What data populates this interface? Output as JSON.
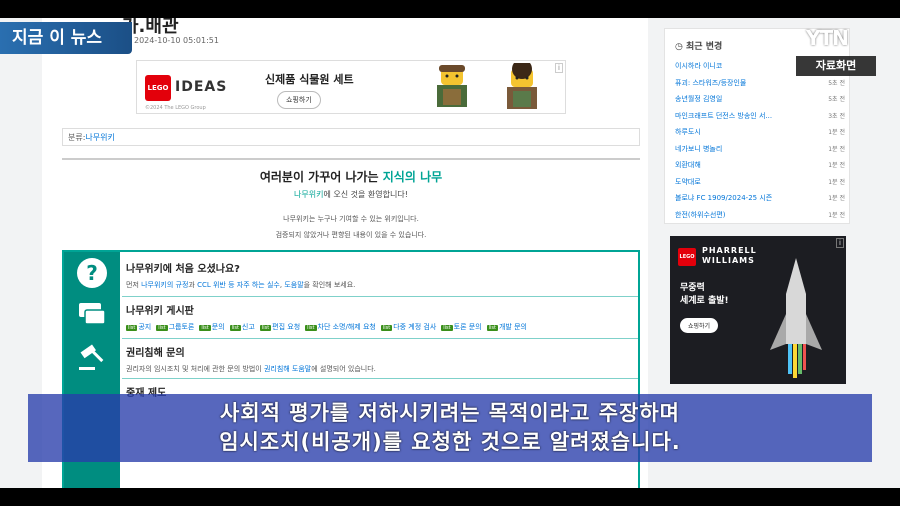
{
  "broadcast": {
    "news_label": "지금 이 뉴스",
    "channel_logo": "YTN",
    "archive_badge": "자료화면",
    "subtitle_line1": "사회적 평가를 저하시키려는 목적이라고 주장하며",
    "subtitle_line2": "임시조치(비공개)를 요청한 것으로 알려졌습니다."
  },
  "document": {
    "title": "가.배관",
    "date": "2024-10-10 05:01:51"
  },
  "ad_lego": {
    "brand": "LEGO",
    "line": "IDEAS",
    "headline": "신제품 식물원 세트",
    "cta": "쇼핑하기",
    "copyright": "©2024 The LEGO Group"
  },
  "category": {
    "label": "분류:",
    "link": "나무위키"
  },
  "welcome": {
    "title_prefix": "여러분이 가꾸어 나가는 ",
    "title_highlight": "지식의 나무",
    "sub_link": "나무위키",
    "sub_text": "에 오신 것을 환영합니다!",
    "note1": "나무위키는 누구나 기여할 수 있는 위키입니다.",
    "note2": "검증되지 않았거나 편향된 내용이 있을 수 있습니다."
  },
  "help": {
    "first_title": "나무위키에 처음 오셨나요?",
    "first_desc_a": "먼저 ",
    "first_desc_link1": "나무위키의 규정",
    "first_desc_b": "과 ",
    "first_desc_link2": "CCL 위반 등 자주 하는 실수",
    "first_desc_c": ", ",
    "first_desc_link3": "도움말",
    "first_desc_d": "을 확인해 보세요.",
    "board_title": "나무위키 게시판",
    "board_links": [
      "공지",
      "그룹토론",
      "문의",
      "신고",
      "편집 요청",
      "차단 소명/해제 요청",
      "다중 계정 검사",
      "토론 문의",
      "개발 문의"
    ],
    "board_tag": "list",
    "rights_title": "권리침해 문의",
    "rights_desc_a": "권리자의 임시조치 및 처리에 관한 문의 방법이 ",
    "rights_desc_link": "권리침해 도움말",
    "rights_desc_b": "에 설명되어 있습니다.",
    "sanction_title": "중재 제도"
  },
  "recent": {
    "header": "최근 변경",
    "items": [
      {
        "name": "이시하라 이니코",
        "time": "1초 전"
      },
      {
        "name": "퓨괴: 스타워즈/등장인물",
        "time": "5초 전"
      },
      {
        "name": "송년월정 김영일",
        "time": "5초 전"
      },
      {
        "name": "마인크래프트 던전스 방송인 서...",
        "time": "3초 전"
      },
      {
        "name": "하루도시",
        "time": "1분 전"
      },
      {
        "name": "네가보니 병놀리",
        "time": "1분 전"
      },
      {
        "name": "외환대해",
        "time": "1분 전"
      },
      {
        "name": "도약대로",
        "time": "1분 전"
      },
      {
        "name": "볼로냐 FC 1909/2024-25 시즌",
        "time": "1분 전"
      },
      {
        "name": "한전(하위수선편)",
        "time": "1분 전"
      }
    ]
  },
  "ad_pharrell": {
    "brand": "LEGO",
    "name_line1": "PHARRELL",
    "name_line2": "WILLIAMS",
    "copy_line1": "무중력",
    "copy_line2": "세계로 출발!",
    "cta": "쇼핑하기"
  },
  "icons": {
    "question": "question-circle-icon",
    "board": "chat-bubble-icon",
    "rights": "gavel-icon"
  },
  "colors": {
    "accent": "#00a495",
    "accent_dark": "#008d80",
    "link": "#0275d8",
    "subtitle_bg": "#283caa",
    "news_label": "#2a6fb0"
  }
}
